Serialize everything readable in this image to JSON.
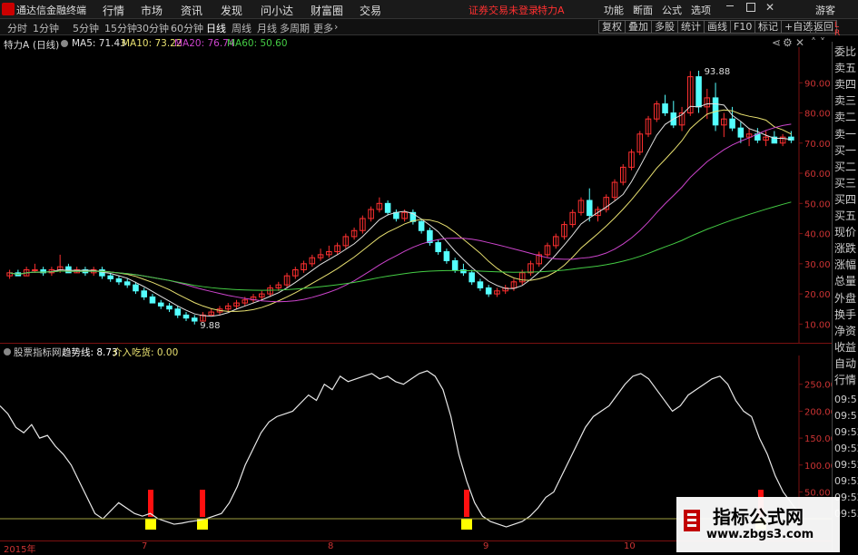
{
  "app": {
    "name": "通达信金融终端",
    "menu": [
      "行情",
      "市场",
      "资讯",
      "发现",
      "问小达",
      "财富圈",
      "交易"
    ],
    "warning": "证券交易未登录",
    "stock": "特力A",
    "right_menu": [
      "功能",
      "断面",
      "公式",
      "选项"
    ],
    "guest": "游客"
  },
  "tabs": {
    "items": [
      "分时",
      "1分钟",
      "5分钟",
      "15分钟",
      "30分钟",
      "60分钟",
      "日线",
      "周线",
      "月线",
      "多周期",
      "更多"
    ],
    "active": "日线",
    "right_buttons": [
      "复权",
      "叠加",
      "多股",
      "统计",
      "画线",
      "F10",
      "标记",
      "+自选",
      "返回"
    ]
  },
  "main_panel": {
    "title": "特力A",
    "period": "(日线)",
    "ma": [
      {
        "label": "MA5: 71.43",
        "color": "#e0e0e0"
      },
      {
        "label": "MA10: 73.22",
        "color": "#e8e070"
      },
      {
        "label": "MA20: 76.74",
        "color": "#cc44cc"
      },
      {
        "label": "MA60: 50.60",
        "color": "#44cc44"
      }
    ],
    "y_ticks": [
      "90.00",
      "80.00",
      "70.00",
      "60.00",
      "50.00",
      "40.00",
      "30.00",
      "20.00",
      "10.00"
    ],
    "annot_high": "93.88",
    "annot_low": "9.88"
  },
  "sub_panel": {
    "name": "股票指标网",
    "line1": "趋势线: 8.73",
    "line2": "介入吃货: 0.00",
    "y_ticks": [
      "250.00",
      "200.00",
      "150.00",
      "100.00",
      "50.00"
    ],
    "x_labels": [
      "2015年",
      "7",
      "8",
      "9",
      "10"
    ]
  },
  "right_column": {
    "corner": "L\nR",
    "items": [
      "委比",
      "卖五",
      "卖四",
      "卖三",
      "卖二",
      "卖一",
      "买一",
      "买二",
      "买三",
      "买四",
      "买五",
      "现价",
      "涨跌",
      "涨幅",
      "总量",
      "外盘",
      "换手",
      "净资",
      "收益",
      "自动",
      "行情"
    ],
    "times": [
      "09:51",
      "09:51",
      "09:52",
      "09:52",
      "09:52",
      "09:52",
      "09:52",
      "09:53"
    ]
  },
  "watermark": {
    "line1": "指标公式网",
    "line2": "www.zbgs3.com"
  },
  "chart_data": {
    "type": "candlestick",
    "ylim": [
      5,
      100
    ],
    "candles": [
      [
        26,
        28,
        25,
        27
      ],
      [
        27,
        28,
        26,
        26
      ],
      [
        26,
        29,
        26,
        28
      ],
      [
        28,
        30,
        27,
        28
      ],
      [
        28,
        29,
        26,
        27
      ],
      [
        27,
        29,
        26,
        28
      ],
      [
        28,
        33,
        27,
        29
      ],
      [
        29,
        30,
        27,
        27
      ],
      [
        27,
        29,
        27,
        28
      ],
      [
        28,
        29,
        26,
        27
      ],
      [
        27,
        29,
        26,
        28
      ],
      [
        28,
        29,
        25,
        26
      ],
      [
        26,
        27,
        24,
        25
      ],
      [
        25,
        26,
        23,
        24
      ],
      [
        24,
        25,
        22,
        23
      ],
      [
        23,
        24,
        20,
        21
      ],
      [
        21,
        22,
        18,
        19
      ],
      [
        19,
        20,
        17,
        17
      ],
      [
        17,
        18,
        15,
        16
      ],
      [
        16,
        17,
        14,
        15
      ],
      [
        15,
        16,
        12,
        13
      ],
      [
        13,
        14,
        11,
        12
      ],
      [
        12,
        13,
        9.88,
        11
      ],
      [
        11,
        14,
        11,
        13
      ],
      [
        13,
        15,
        13,
        14
      ],
      [
        14,
        16,
        13,
        15
      ],
      [
        15,
        17,
        14,
        16
      ],
      [
        16,
        18,
        15,
        17
      ],
      [
        17,
        19,
        16,
        18
      ],
      [
        18,
        20,
        17,
        19
      ],
      [
        19,
        21,
        18,
        20
      ],
      [
        20,
        23,
        19,
        22
      ],
      [
        22,
        24,
        21,
        23
      ],
      [
        23,
        27,
        22,
        26
      ],
      [
        26,
        29,
        25,
        28
      ],
      [
        28,
        31,
        27,
        30
      ],
      [
        30,
        33,
        29,
        32
      ],
      [
        32,
        35,
        31,
        33
      ],
      [
        33,
        36,
        32,
        34
      ],
      [
        34,
        37,
        33,
        36
      ],
      [
        36,
        40,
        35,
        39
      ],
      [
        39,
        42,
        38,
        41
      ],
      [
        41,
        46,
        40,
        45
      ],
      [
        45,
        49,
        44,
        48
      ],
      [
        48,
        52,
        47,
        50
      ],
      [
        50,
        51,
        46,
        47
      ],
      [
        47,
        48,
        44,
        45
      ],
      [
        45,
        48,
        44,
        47
      ],
      [
        47,
        48,
        43,
        44
      ],
      [
        44,
        45,
        40,
        41
      ],
      [
        41,
        42,
        36,
        37
      ],
      [
        37,
        38,
        33,
        34
      ],
      [
        34,
        35,
        30,
        31
      ],
      [
        31,
        32,
        27,
        28
      ],
      [
        28,
        30,
        26,
        27
      ],
      [
        27,
        28,
        23,
        24
      ],
      [
        24,
        25,
        21,
        22
      ],
      [
        22,
        23,
        19,
        20
      ],
      [
        20,
        22,
        19,
        21
      ],
      [
        21,
        23,
        20,
        22
      ],
      [
        22,
        25,
        21,
        24
      ],
      [
        24,
        28,
        23,
        27
      ],
      [
        27,
        31,
        26,
        30
      ],
      [
        30,
        34,
        29,
        33
      ],
      [
        33,
        37,
        32,
        36
      ],
      [
        36,
        40,
        35,
        39
      ],
      [
        39,
        44,
        38,
        43
      ],
      [
        43,
        48,
        42,
        47
      ],
      [
        47,
        52,
        46,
        51
      ],
      [
        51,
        55,
        44,
        46
      ],
      [
        46,
        49,
        44,
        48
      ],
      [
        48,
        53,
        47,
        52
      ],
      [
        52,
        58,
        51,
        57
      ],
      [
        57,
        63,
        56,
        62
      ],
      [
        62,
        68,
        61,
        67
      ],
      [
        67,
        74,
        66,
        73
      ],
      [
        73,
        79,
        72,
        78
      ],
      [
        78,
        84,
        77,
        83
      ],
      [
        83,
        86,
        79,
        80
      ],
      [
        80,
        84,
        75,
        76
      ],
      [
        76,
        82,
        74,
        80
      ],
      [
        80,
        93.88,
        79,
        92
      ],
      [
        92,
        94,
        80,
        82
      ],
      [
        82,
        88,
        78,
        85
      ],
      [
        85,
        90,
        74,
        76
      ],
      [
        76,
        80,
        72,
        78
      ],
      [
        78,
        82,
        74,
        75
      ],
      [
        75,
        77,
        70,
        72
      ],
      [
        72,
        75,
        69,
        73
      ],
      [
        73,
        75,
        70,
        71
      ],
      [
        71,
        74,
        69,
        72
      ],
      [
        72,
        74,
        70,
        70
      ],
      [
        70,
        73,
        69,
        72
      ],
      [
        72,
        74,
        70,
        71
      ]
    ],
    "ma": {
      "MA5": "white",
      "MA10": "yellow",
      "MA20": "magenta",
      "MA60": "green"
    },
    "indicator": {
      "trend": [
        210,
        195,
        170,
        160,
        175,
        150,
        155,
        135,
        120,
        100,
        70,
        40,
        10,
        0,
        15,
        30,
        20,
        10,
        5,
        10,
        0,
        -5,
        -10,
        -8,
        -5,
        -3,
        0,
        5,
        10,
        30,
        60,
        100,
        130,
        160,
        180,
        190,
        195,
        200,
        215,
        230,
        220,
        250,
        240,
        265,
        255,
        260,
        265,
        270,
        260,
        265,
        255,
        250,
        260,
        270,
        275,
        265,
        240,
        190,
        120,
        70,
        30,
        5,
        -5,
        -10,
        -15,
        -10,
        -5,
        5,
        20,
        40,
        50,
        80,
        110,
        140,
        170,
        190,
        200,
        210,
        230,
        250,
        265,
        270,
        260,
        240,
        220,
        200,
        210,
        230,
        240,
        250,
        260,
        265,
        250,
        220,
        200,
        190,
        150,
        120,
        80,
        50,
        30,
        10
      ]
    },
    "signals": [
      {
        "x": 21,
        "bar": "up"
      },
      {
        "x": 28,
        "bar": "up"
      },
      {
        "x": 64,
        "bar": "up"
      },
      {
        "x": 105,
        "bar": "up"
      }
    ]
  }
}
